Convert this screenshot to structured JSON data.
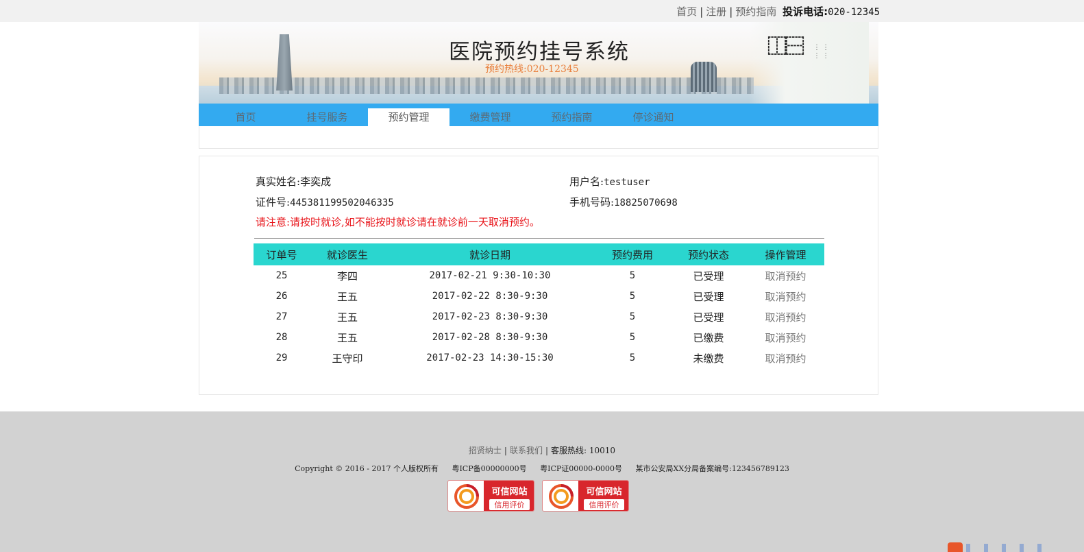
{
  "topbar": {
    "links": [
      "首页",
      "注册",
      "预约指南"
    ],
    "phone_label": "投诉电话:",
    "phone": "020-12345"
  },
  "banner": {
    "title": "医院预约挂号系统",
    "hotline": "预约热线:020-12345"
  },
  "nav": {
    "items": [
      "首页",
      "挂号服务",
      "预约管理",
      "缴费管理",
      "预约指南",
      "停诊通知"
    ],
    "active_index": 2
  },
  "profile": {
    "real_name_label": "真实姓名:",
    "real_name": "李奕成",
    "username_label": "用户名:",
    "username": "testuser",
    "id_label": "证件号:",
    "id_number": "445381199502046335",
    "phone_label": "手机号码:",
    "phone": "18825070698",
    "notice": "请注意:请按时就诊,如不能按时就诊请在就诊前一天取消预约。"
  },
  "orders": {
    "headers": [
      "订单号",
      "就诊医生",
      "就诊日期",
      "预约费用",
      "预约状态",
      "操作管理"
    ],
    "rows": [
      {
        "id": "25",
        "doctor": "李四",
        "date": "2017-02-21 9:30-10:30",
        "fee": "5",
        "status": "已受理",
        "action": "取消预约"
      },
      {
        "id": "26",
        "doctor": "王五",
        "date": "2017-02-22 8:30-9:30",
        "fee": "5",
        "status": "已受理",
        "action": "取消预约"
      },
      {
        "id": "27",
        "doctor": "王五",
        "date": "2017-02-23 8:30-9:30",
        "fee": "5",
        "status": "已受理",
        "action": "取消预约"
      },
      {
        "id": "28",
        "doctor": "王五",
        "date": "2017-02-28 8:30-9:30",
        "fee": "5",
        "status": "已缴费",
        "action": "取消预约"
      },
      {
        "id": "29",
        "doctor": "王守印",
        "date": "2017-02-23 14:30-15:30",
        "fee": "5",
        "status": "未缴费",
        "action": "取消预约"
      }
    ]
  },
  "footer": {
    "links": [
      "招贤纳士",
      "联系我们"
    ],
    "hotline": "客服热线: 10010",
    "copyright": "Copyright © 2016 - 2017 个人版权所有",
    "icp1": "粤ICP备00000000号",
    "icp2": "粤ICP证00000-0000号",
    "police": "某市公安局XX分局备案编号:123456789123",
    "badge_title": "可信网站",
    "badge_sub": "信用评价"
  },
  "colors": {
    "nav_bg": "#33aaf0",
    "table_header_bg": "#2ad6cf",
    "notice": "#e8141a",
    "footer_bg": "#d2d2d2",
    "hotline": "#e9813f"
  }
}
